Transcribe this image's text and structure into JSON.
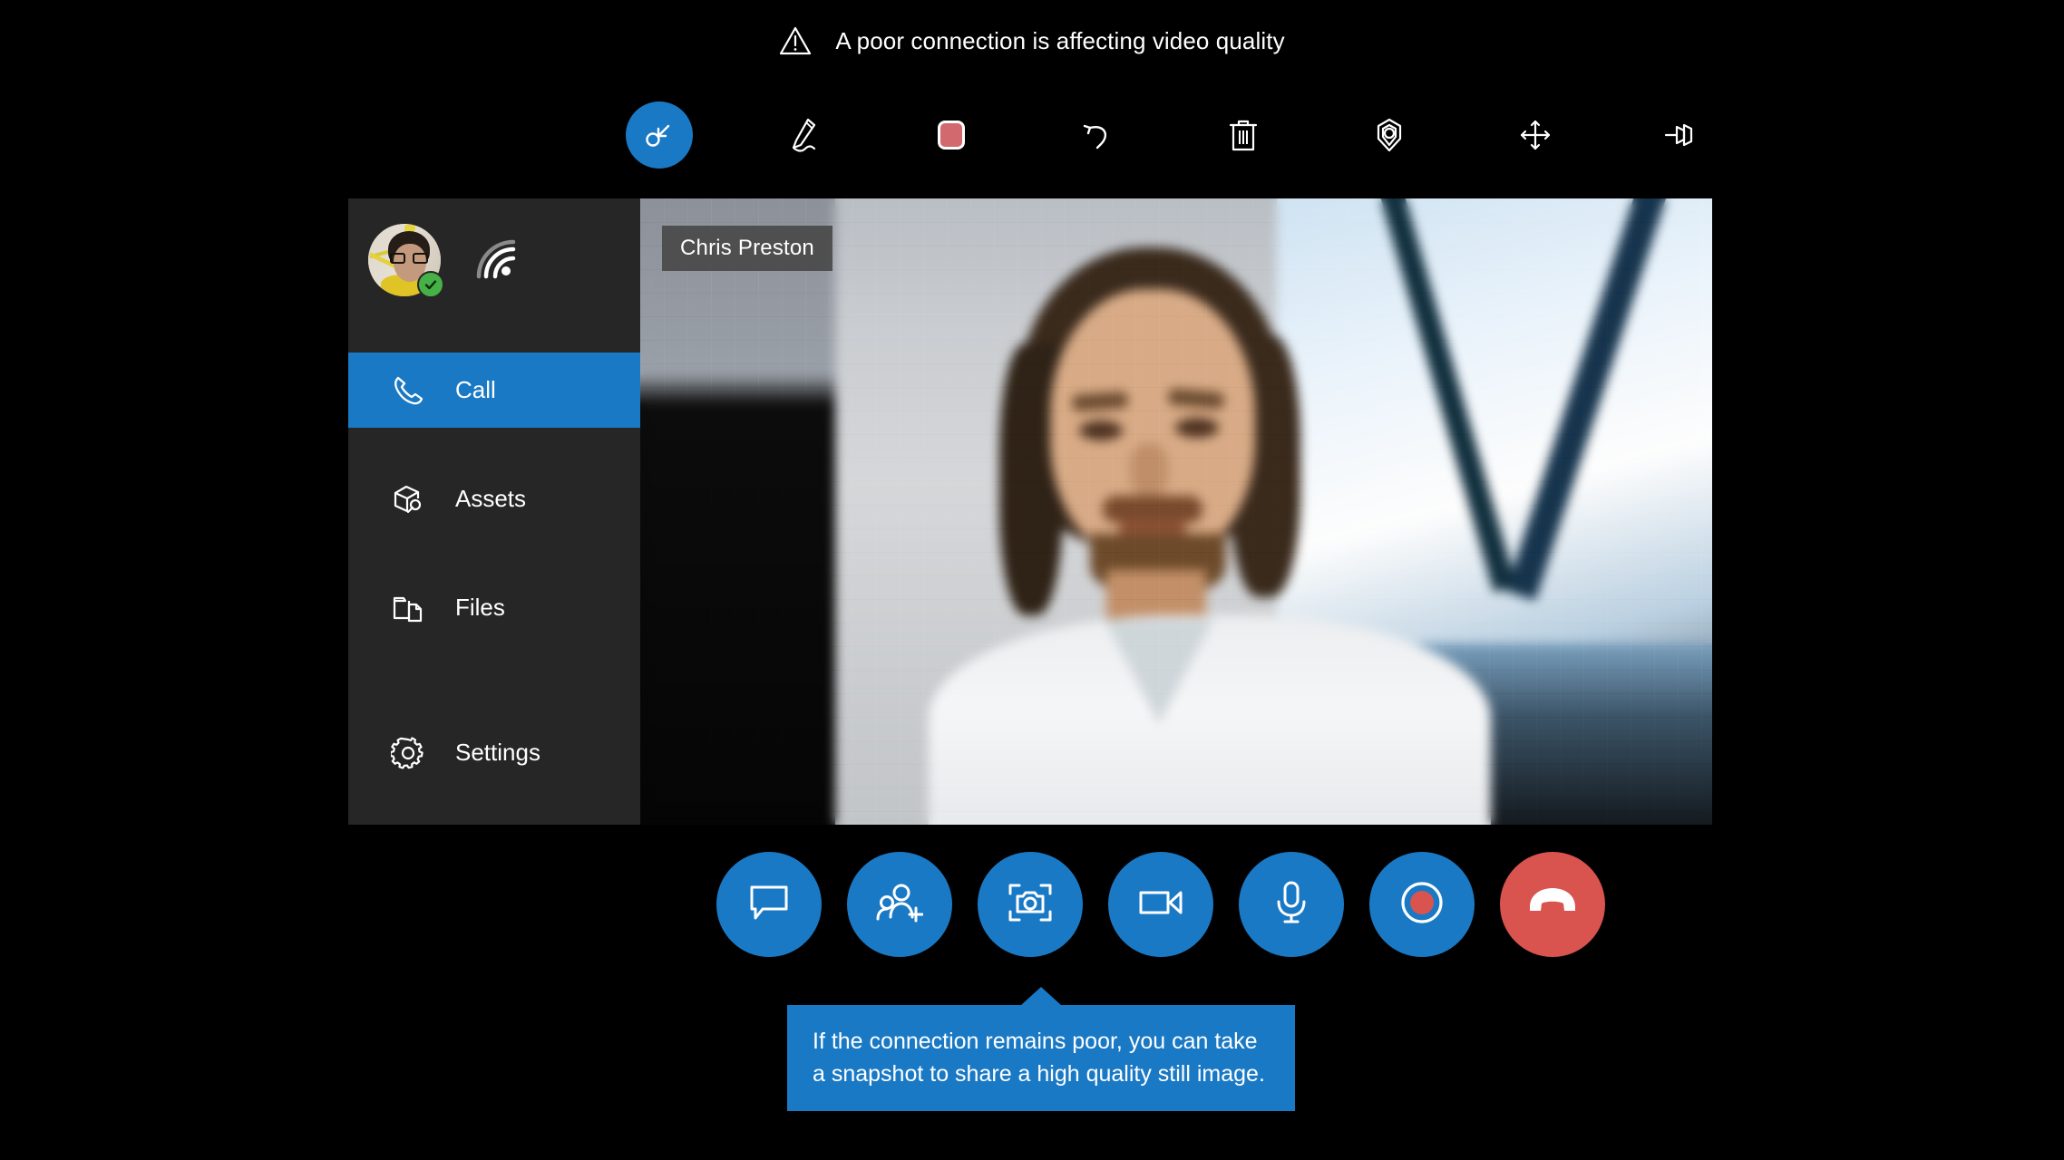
{
  "banner": {
    "icon": "warning-triangle-icon",
    "text": "A poor connection is affecting video quality"
  },
  "toolbar": {
    "items": [
      {
        "name": "select-tool",
        "icon": "cursor-select-icon",
        "label": "Select",
        "active": true
      },
      {
        "name": "pen-tool",
        "icon": "pen-ink-icon",
        "label": "Pen",
        "active": false
      },
      {
        "name": "color-swatch",
        "icon": "color-swatch-icon",
        "label": "Color",
        "active": false,
        "color": "#D2696E"
      },
      {
        "name": "undo-tool",
        "icon": "undo-arrow-icon",
        "label": "Undo",
        "active": false
      },
      {
        "name": "delete-tool",
        "icon": "trash-icon",
        "label": "Delete",
        "active": false
      },
      {
        "name": "place-marker-tool",
        "icon": "location-pin-icon",
        "label": "Place marker",
        "active": false
      },
      {
        "name": "move-tool",
        "icon": "move-arrows-icon",
        "label": "Move",
        "active": false
      },
      {
        "name": "pin-tool",
        "icon": "pushpin-icon",
        "label": "Pin",
        "active": false
      }
    ]
  },
  "sidebar": {
    "profile": {
      "avatar_name": "user-avatar",
      "presence": "available",
      "presence_icon": "checkmark-icon",
      "signal_icon": "signal-strength-icon"
    },
    "items": [
      {
        "label": "Call",
        "icon": "phone-icon",
        "active": true
      },
      {
        "label": "Assets",
        "icon": "assets-box-wrench-icon",
        "active": false
      },
      {
        "label": "Files",
        "icon": "files-folder-icon",
        "active": false
      },
      {
        "label": "Settings",
        "icon": "gear-icon",
        "active": false
      }
    ]
  },
  "video": {
    "participant_name": "Chris Preston",
    "quality": "degraded"
  },
  "controls": [
    {
      "name": "chat-button",
      "icon": "chat-bubble-icon",
      "label": "Chat",
      "style": "primary"
    },
    {
      "name": "add-people-button",
      "icon": "add-person-icon",
      "label": "Add people",
      "style": "primary"
    },
    {
      "name": "snapshot-button",
      "icon": "camera-snapshot-icon",
      "label": "Take snapshot",
      "style": "primary"
    },
    {
      "name": "video-toggle-button",
      "icon": "video-camera-icon",
      "label": "Video",
      "style": "primary"
    },
    {
      "name": "mic-toggle-button",
      "icon": "microphone-icon",
      "label": "Microphone",
      "style": "primary"
    },
    {
      "name": "record-button",
      "icon": "record-circle-icon",
      "label": "Record",
      "style": "primary"
    },
    {
      "name": "end-call-button",
      "icon": "hangup-phone-icon",
      "label": "End call",
      "style": "danger"
    }
  ],
  "tooltip": {
    "text": "If the connection remains poor, you can take a snapshot to share a high quality still image."
  },
  "colors": {
    "accent": "#1A79C5",
    "danger": "#D9534F",
    "swatch": "#D2696E",
    "presence": "#46B146",
    "sidebar_bg": "#262626",
    "page_bg": "#000000"
  }
}
